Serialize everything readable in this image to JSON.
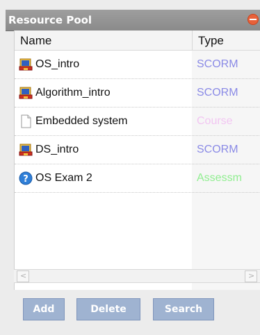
{
  "panel": {
    "title": "Resource Pool",
    "close_icon": "minus-circle-icon"
  },
  "grid": {
    "columns": [
      "Name",
      "Type"
    ],
    "rows": [
      {
        "icon": "scorm-package-icon",
        "name": "OS_intro",
        "type": "SCORM",
        "type_color": "#8a8ae6"
      },
      {
        "icon": "scorm-package-icon",
        "name": "Algorithm_intro",
        "type": "SCORM",
        "type_color": "#8a8ae6"
      },
      {
        "icon": "document-icon",
        "name": "Embedded system",
        "type": "Course",
        "type_color": "#f2c6f2"
      },
      {
        "icon": "scorm-package-icon",
        "name": "DS_intro",
        "type": "SCORM",
        "type_color": "#8a8ae6"
      },
      {
        "icon": "question-mark-icon",
        "name": "OS Exam 2",
        "type": "Assessm",
        "type_color": "#90ee90"
      }
    ]
  },
  "scrollbar": {
    "left_arrow": "<",
    "right_arrow": ">"
  },
  "buttons": {
    "add": "Add",
    "delete": "Delete",
    "search": "Search"
  }
}
